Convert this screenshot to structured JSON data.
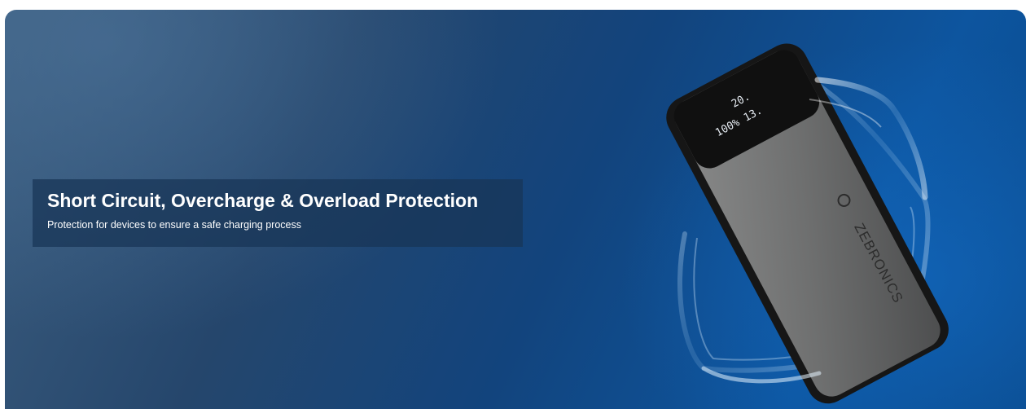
{
  "banner": {
    "title": "Short Circuit, Overcharge & Overload Protection",
    "subtitle": "Protection for devices to ensure a safe charging process"
  },
  "product": {
    "brand": "ZEBRONICS",
    "display_top": "20.",
    "display_bottom": "100% 13."
  },
  "colors": {
    "background_dark": "#12447d",
    "background_accent": "#0d559f",
    "caption_box": "#183456",
    "product_body": "#6e6f6f",
    "product_bezel": "#151515"
  },
  "icons": {
    "shield": "shield-icon",
    "brand_logo": "zebronics-logo-icon"
  }
}
